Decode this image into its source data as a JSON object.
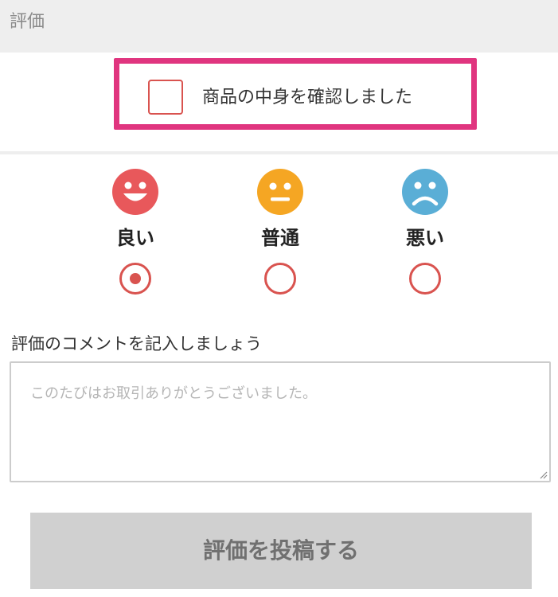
{
  "header": {
    "title": "評価"
  },
  "confirm": {
    "label": "商品の中身を確認しました",
    "checked": false
  },
  "ratings": [
    {
      "key": "good",
      "label": "良い",
      "icon": "smile-face-icon",
      "color": "#e8585b",
      "selected": true
    },
    {
      "key": "normal",
      "label": "普通",
      "icon": "neutral-face-icon",
      "color": "#f5a623",
      "selected": false
    },
    {
      "key": "bad",
      "label": "悪い",
      "icon": "sad-face-icon",
      "color": "#5aaed6",
      "selected": false
    }
  ],
  "comment": {
    "label": "評価のコメントを記入しましょう",
    "placeholder": "このたびはお取引ありがとうございました。",
    "value": ""
  },
  "submit": {
    "label": "評価を投稿する"
  },
  "colors": {
    "accent_red": "#d9534f",
    "highlight_pink": "#e0357f",
    "button_disabled_bg": "#d0d0d0"
  }
}
